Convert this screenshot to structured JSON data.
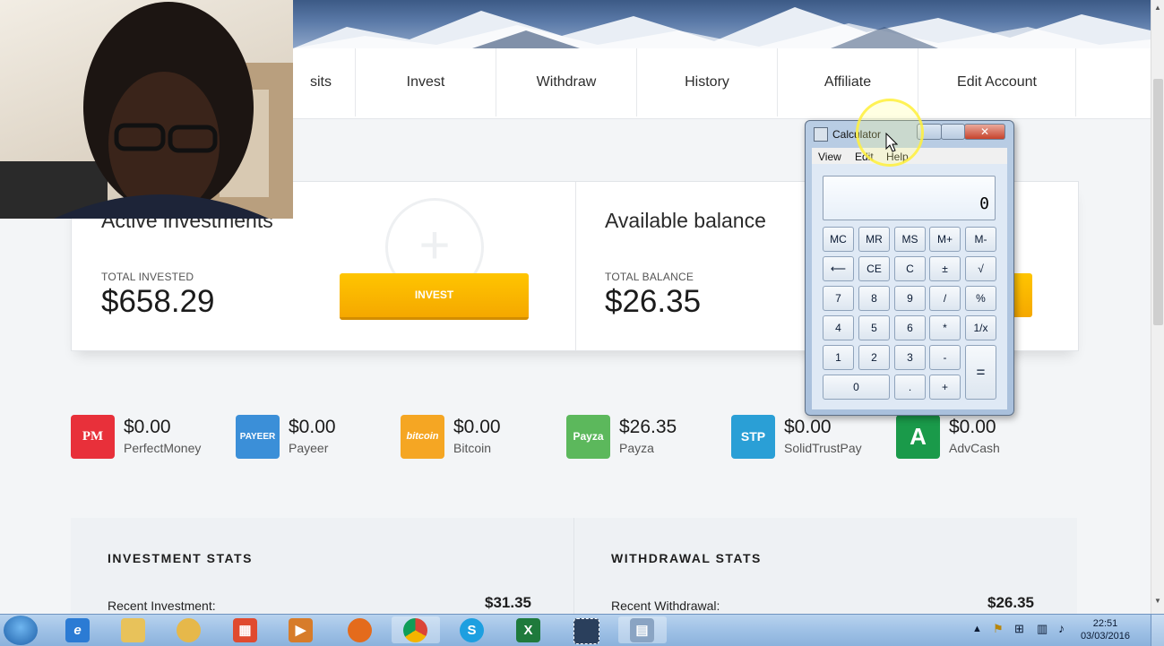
{
  "nav": {
    "items": [
      "sits",
      "Invest",
      "Withdraw",
      "History",
      "Affiliate",
      "Edit Account"
    ]
  },
  "cards": {
    "active": {
      "title": "Active investments",
      "label": "TOTAL INVESTED",
      "amount": "$658.29",
      "button": "INVEST"
    },
    "balance": {
      "title": "Available balance",
      "label": "TOTAL BALANCE",
      "amount": "$26.35"
    }
  },
  "payments": [
    {
      "name": "PerfectMoney",
      "amount": "$0.00",
      "logo_text": "PM",
      "color": "#e8303a"
    },
    {
      "name": "Payeer",
      "amount": "$0.00",
      "logo_text": "PAYEER",
      "color": "#3b8fd8"
    },
    {
      "name": "Bitcoin",
      "amount": "$0.00",
      "logo_text": "bitcoin",
      "color": "#f5a623"
    },
    {
      "name": "Payza",
      "amount": "$26.35",
      "logo_text": "Payza",
      "color": "#5cb85c"
    },
    {
      "name": "SolidTrustPay",
      "amount": "$0.00",
      "logo_text": "STP",
      "color": "#2a9fd6"
    },
    {
      "name": "AdvCash",
      "amount": "$0.00",
      "logo_text": "A",
      "color": "#1a9a4a"
    }
  ],
  "stats": {
    "investment": {
      "title": "INVESTMENT STATS",
      "row_label": "Recent Investment:",
      "row_value": "$31.35"
    },
    "withdrawal": {
      "title": "WITHDRAWAL STATS",
      "row_label": "Recent Withdrawal:",
      "row_value": "$26.35"
    }
  },
  "calculator": {
    "title": "Calculator",
    "menu": [
      "View",
      "Edit",
      "Help"
    ],
    "display": "0",
    "buttons": {
      "mc": "MC",
      "mr": "MR",
      "ms": "MS",
      "mplus": "M+",
      "mminus": "M-",
      "back": "⟵",
      "ce": "CE",
      "c": "C",
      "plusminus": "±",
      "sqrt": "√",
      "n7": "7",
      "n8": "8",
      "n9": "9",
      "div": "/",
      "pct": "%",
      "n4": "4",
      "n5": "5",
      "n6": "6",
      "mul": "*",
      "recip": "1/x",
      "n1": "1",
      "n2": "2",
      "n3": "3",
      "minus": "-",
      "eq": "=",
      "n0": "0",
      "dot": ".",
      "plus": "+"
    }
  },
  "taskbar": {
    "time": "22:51",
    "date": "03/03/2016"
  },
  "colors": {
    "accent": "#f5a800",
    "taskbar": "#9fc1e6"
  }
}
